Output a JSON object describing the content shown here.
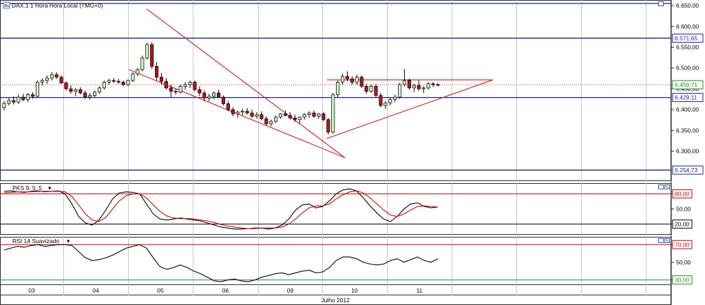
{
  "chart_data": [
    {
      "type": "candlestick",
      "title": "DAX.1 1 Hora Hora Local (TMG+0)",
      "x": [
        "03",
        "04",
        "05",
        "06",
        "09",
        "10",
        "11"
      ],
      "x_group_label": "Julho 2012",
      "ylim": [
        6230,
        6660
      ],
      "y_ticks": [
        "6.650,00",
        "6.600,00",
        "6.550,00",
        "6.500,00",
        "6.450,00",
        "6.400,00",
        "6.350,00",
        "6.300,00"
      ],
      "y_tick_values": [
        6650,
        6600,
        6550,
        6500,
        6450,
        6400,
        6350,
        6300
      ],
      "price_labels": [
        {
          "text": "6.571,65",
          "value": 6571.65,
          "style": "horizontal-line",
          "color": "#1a1aa6"
        },
        {
          "text": "6.459,71",
          "value": 6459.71,
          "style": "current-price",
          "color": "#1f8a1f"
        },
        {
          "text": "6.429,11",
          "value": 6429.11,
          "style": "horizontal-line",
          "color": "#1a1aa6"
        },
        {
          "text": "6.254,73",
          "value": 6254.73,
          "style": "horizontal-line",
          "color": "#1a1aa6"
        }
      ],
      "last_price": 6459.71,
      "ohlc": [
        [
          6405,
          6420,
          6398,
          6415
        ],
        [
          6415,
          6428,
          6410,
          6422
        ],
        [
          6422,
          6432,
          6412,
          6418
        ],
        [
          6418,
          6436,
          6414,
          6430
        ],
        [
          6430,
          6438,
          6420,
          6424
        ],
        [
          6424,
          6440,
          6418,
          6436
        ],
        [
          6436,
          6442,
          6426,
          6432
        ],
        [
          6432,
          6470,
          6428,
          6466
        ],
        [
          6466,
          6475,
          6458,
          6470
        ],
        [
          6470,
          6482,
          6462,
          6476
        ],
        [
          6476,
          6490,
          6470,
          6484
        ],
        [
          6484,
          6490,
          6474,
          6478
        ],
        [
          6478,
          6482,
          6462,
          6464
        ],
        [
          6464,
          6468,
          6446,
          6450
        ],
        [
          6450,
          6458,
          6438,
          6444
        ],
        [
          6444,
          6452,
          6432,
          6448
        ],
        [
          6448,
          6454,
          6436,
          6440
        ],
        [
          6440,
          6446,
          6426,
          6430
        ],
        [
          6430,
          6440,
          6424,
          6434
        ],
        [
          6434,
          6446,
          6430,
          6442
        ],
        [
          6442,
          6456,
          6438,
          6452
        ],
        [
          6452,
          6470,
          6448,
          6466
        ],
        [
          6466,
          6474,
          6460,
          6470
        ],
        [
          6470,
          6476,
          6464,
          6468
        ],
        [
          6468,
          6474,
          6462,
          6466
        ],
        [
          6466,
          6470,
          6456,
          6460
        ],
        [
          6460,
          6472,
          6456,
          6470
        ],
        [
          6470,
          6490,
          6466,
          6486
        ],
        [
          6486,
          6500,
          6480,
          6496
        ],
        [
          6496,
          6530,
          6492,
          6524
        ],
        [
          6524,
          6560,
          6520,
          6556
        ],
        [
          6556,
          6562,
          6498,
          6504
        ],
        [
          6504,
          6514,
          6470,
          6478
        ],
        [
          6478,
          6488,
          6460,
          6468
        ],
        [
          6468,
          6476,
          6448,
          6452
        ],
        [
          6452,
          6460,
          6430,
          6444
        ],
        [
          6444,
          6450,
          6436,
          6442
        ],
        [
          6442,
          6460,
          6438,
          6456
        ],
        [
          6456,
          6466,
          6448,
          6460
        ],
        [
          6460,
          6470,
          6452,
          6466
        ],
        [
          6466,
          6470,
          6444,
          6448
        ],
        [
          6448,
          6456,
          6432,
          6440
        ],
        [
          6440,
          6446,
          6420,
          6428
        ],
        [
          6428,
          6438,
          6420,
          6432
        ],
        [
          6432,
          6444,
          6426,
          6440
        ],
        [
          6440,
          6448,
          6428,
          6430
        ],
        [
          6430,
          6434,
          6410,
          6414
        ],
        [
          6414,
          6420,
          6396,
          6400
        ],
        [
          6400,
          6406,
          6384,
          6390
        ],
        [
          6390,
          6398,
          6380,
          6394
        ],
        [
          6394,
          6402,
          6386,
          6396
        ],
        [
          6396,
          6404,
          6388,
          6392
        ],
        [
          6392,
          6400,
          6380,
          6384
        ],
        [
          6384,
          6394,
          6378,
          6388
        ],
        [
          6388,
          6396,
          6374,
          6378
        ],
        [
          6378,
          6384,
          6362,
          6366
        ],
        [
          6366,
          6376,
          6360,
          6372
        ],
        [
          6372,
          6386,
          6368,
          6382
        ],
        [
          6382,
          6392,
          6378,
          6390
        ],
        [
          6390,
          6398,
          6384,
          6386
        ],
        [
          6386,
          6394,
          6376,
          6380
        ],
        [
          6380,
          6388,
          6370,
          6376
        ],
        [
          6376,
          6384,
          6366,
          6382
        ],
        [
          6382,
          6392,
          6376,
          6388
        ],
        [
          6388,
          6396,
          6380,
          6392
        ],
        [
          6392,
          6398,
          6380,
          6384
        ],
        [
          6384,
          6392,
          6378,
          6390
        ],
        [
          6390,
          6394,
          6372,
          6376
        ],
        [
          6376,
          6380,
          6340,
          6346
        ],
        [
          6346,
          6440,
          6342,
          6436
        ],
        [
          6436,
          6470,
          6430,
          6466
        ],
        [
          6466,
          6486,
          6460,
          6480
        ],
        [
          6480,
          6492,
          6468,
          6474
        ],
        [
          6474,
          6480,
          6460,
          6466
        ],
        [
          6466,
          6484,
          6460,
          6478
        ],
        [
          6478,
          6482,
          6452,
          6456
        ],
        [
          6456,
          6462,
          6438,
          6444
        ],
        [
          6444,
          6460,
          6440,
          6456
        ],
        [
          6456,
          6462,
          6430,
          6434
        ],
        [
          6434,
          6440,
          6406,
          6410
        ],
        [
          6410,
          6420,
          6402,
          6416
        ],
        [
          6416,
          6428,
          6410,
          6424
        ],
        [
          6424,
          6436,
          6418,
          6430
        ],
        [
          6430,
          6464,
          6426,
          6460
        ],
        [
          6460,
          6498,
          6456,
          6470
        ],
        [
          6470,
          6474,
          6448,
          6452
        ],
        [
          6452,
          6462,
          6442,
          6458
        ],
        [
          6458,
          6470,
          6446,
          6450
        ],
        [
          6450,
          6456,
          6440,
          6452
        ],
        [
          6452,
          6466,
          6448,
          6462
        ],
        [
          6462,
          6466,
          6454,
          6460
        ],
        [
          6460,
          6464,
          6456,
          6459.71
        ]
      ]
    },
    {
      "type": "line",
      "title": "PKS 9; 5; 5",
      "ylim": [
        0,
        100
      ],
      "y_ticks": [
        "80,00",
        "50,00",
        "20,00"
      ],
      "y_tick_values": [
        80,
        50,
        20
      ],
      "levels": [
        80,
        20
      ],
      "series": [
        {
          "color": "#000000",
          "values": [
            85,
            86,
            84,
            83,
            85,
            86,
            84,
            85,
            86,
            80,
            60,
            35,
            22,
            18,
            28,
            48,
            70,
            82,
            84,
            83,
            80,
            60,
            40,
            30,
            28,
            30,
            32,
            30,
            28,
            26,
            22,
            18,
            14,
            12,
            10,
            10,
            11,
            12,
            12,
            10,
            12,
            18,
            30,
            48,
            58,
            60,
            52,
            55,
            66,
            80,
            88,
            90,
            86,
            72,
            56,
            42,
            30,
            25,
            35,
            50,
            60,
            62,
            55,
            52,
            54
          ]
        },
        {
          "color": "#cc0000",
          "values": [
            82,
            83,
            84,
            84,
            84,
            85,
            85,
            85,
            85,
            84,
            75,
            58,
            40,
            28,
            25,
            33,
            50,
            66,
            76,
            80,
            80,
            72,
            58,
            45,
            36,
            32,
            31,
            31,
            30,
            28,
            26,
            23,
            19,
            16,
            14,
            12,
            11,
            11,
            12,
            12,
            12,
            14,
            20,
            30,
            42,
            52,
            56,
            56,
            60,
            70,
            78,
            84,
            86,
            82,
            72,
            60,
            48,
            38,
            35,
            40,
            48,
            55,
            56,
            55,
            54
          ]
        }
      ]
    },
    {
      "type": "line",
      "title": "RSI 14 Suavizado",
      "ylim": [
        25,
        78
      ],
      "y_ticks": [
        "70,00",
        "50,00",
        "30,00"
      ],
      "y_tick_values": [
        70,
        50,
        30
      ],
      "levels": [
        70,
        30
      ],
      "series": [
        {
          "color": "#000000",
          "values": [
            64,
            66,
            68,
            67,
            69,
            70,
            68,
            69,
            70,
            70,
            69,
            62,
            55,
            52,
            53,
            55,
            58,
            62,
            66,
            68,
            70,
            66,
            55,
            45,
            42,
            44,
            47,
            44,
            40,
            37,
            33,
            29,
            28,
            30,
            31,
            29,
            28,
            30,
            33,
            35,
            37,
            38,
            36,
            38,
            40,
            41,
            38,
            39,
            44,
            52,
            56,
            56,
            54,
            50,
            48,
            47,
            48,
            52,
            54,
            50,
            53,
            56,
            52,
            50,
            54
          ]
        }
      ]
    }
  ]
}
